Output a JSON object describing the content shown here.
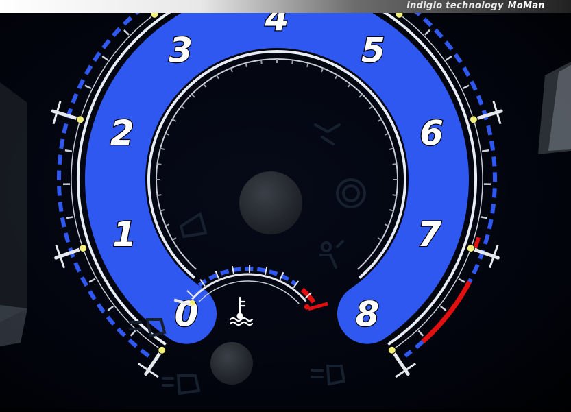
{
  "banner": {
    "text": "indiglo technology",
    "brand": "MoMan"
  },
  "gauge": {
    "numerals": [
      "0",
      "1",
      "2",
      "3",
      "4",
      "5",
      "6",
      "7",
      "8"
    ],
    "accent_color": "#2f58f0",
    "redline_color": "#e01010",
    "marker_color": "#f2f07a"
  },
  "icons": [
    "hand-brake-icon",
    "seatbelt-icon",
    "airbag-icon",
    "coolant-temperature-icon",
    "fog-light-icon",
    "rear-fog-light-icon",
    "headlight-icon"
  ]
}
